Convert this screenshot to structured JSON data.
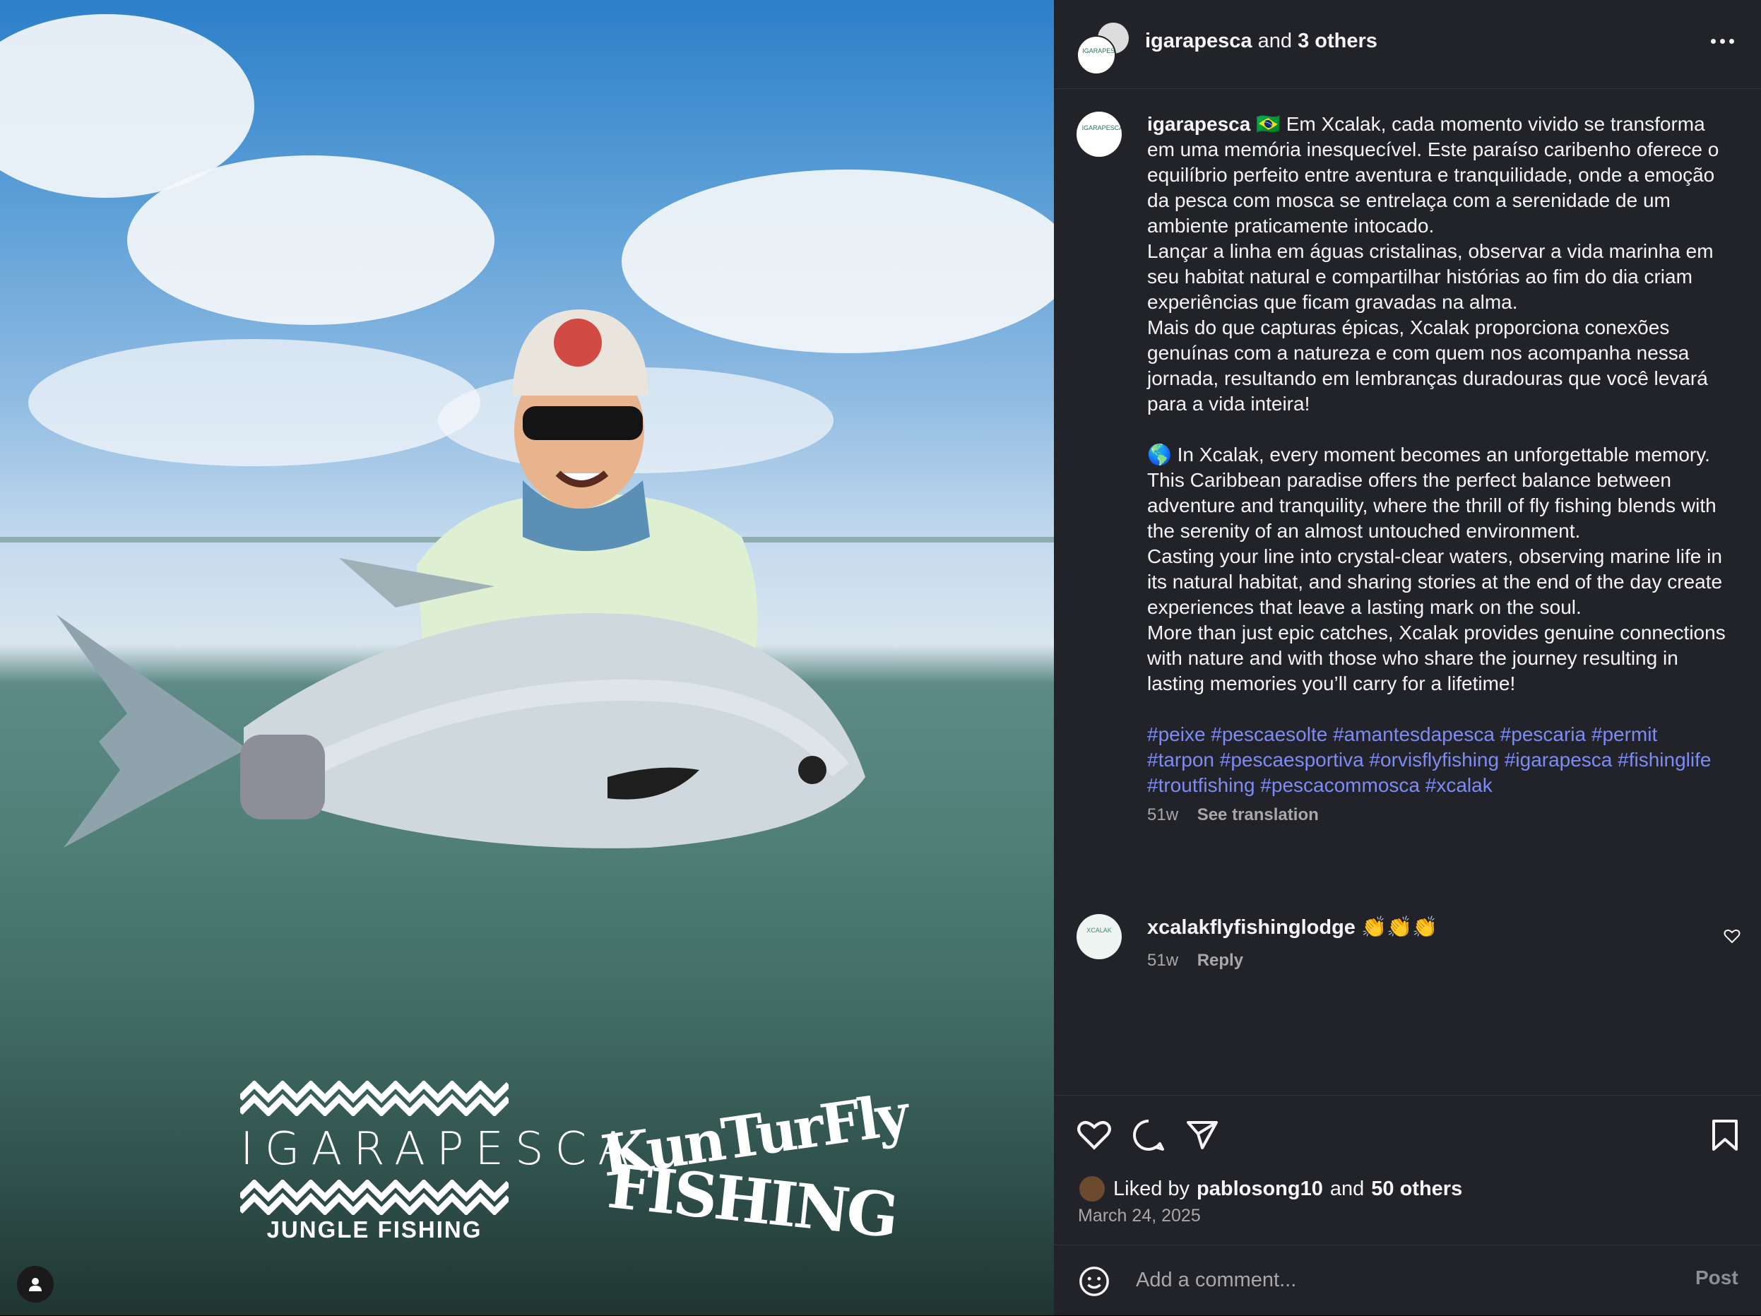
{
  "post": {
    "author": "igarapesca",
    "coauthors_suffix": "and",
    "coauthors_count": "3 others",
    "caption_lines_pt": [
      "🇧🇷 Em Xcalak, cada momento vivido se transforma em uma memória inesquecível. Este paraíso caribenho oferece o equilíbrio perfeito entre aventura e tranquilidade, onde a emoção da pesca com mosca se entrelaça com a serenidade de um ambiente praticamente intocado.",
      "Lançar a linha em águas cristalinas, observar a vida marinha em seu habitat natural e compartilhar histórias ao fim do dia criam experiências que ficam gravadas na alma.",
      "Mais do que capturas épicas, Xcalak proporciona conexões genuínas com a natureza e com quem nos acompanha nessa jornada, resultando em lembranças duradouras que você levará para a vida inteira!"
    ],
    "caption_lines_en": [
      "🌎 In Xcalak, every moment becomes an unforgettable memory. This Caribbean paradise offers the perfect balance between adventure and tranquility, where the thrill of fly fishing blends with the serenity of an almost untouched environment.",
      "Casting your line into crystal-clear waters, observing marine life in its natural habitat, and sharing stories at the end of the day create experiences that leave a lasting mark on the soul.",
      "More than just epic catches, Xcalak provides genuine connections with nature and with those who share the journey resulting in lasting memories you’ll carry for a lifetime!"
    ],
    "hashtags": "#peixe #pescaesolte #amantesdapesca #pescaria #permit #tarpon #pescaesportiva #orvisflyfishing #igarapesca #fishinglife #troutfishing #pescacommosca #xcalak",
    "age": "51w",
    "see_translation": "See translation",
    "likes_prefix": "Liked by",
    "liked_by_user": "pablosong10",
    "likes_and": "and",
    "likes_others": "50 others",
    "date": "March 24, 2025"
  },
  "comment": {
    "user": "xcalakflyfishinglodge",
    "text": "👏👏👏",
    "age": "51w",
    "reply_label": "Reply"
  },
  "comment_input": {
    "placeholder": "Add a comment...",
    "post_label": "Post"
  },
  "media": {
    "logo_left_word": "IGARAPESCA",
    "logo_left_sub": "JUNGLE FISHING",
    "logo_right_line1": "KunTurFly",
    "logo_right_line2": "FISHING"
  },
  "avatar_text": {
    "igarapesca": "IGARAPESCA",
    "xcalak": "XCALAK"
  },
  "colors": {
    "panel_bg": "#212328",
    "hashtag": "#7d8cf4",
    "muted": "#a8a8a8"
  },
  "icons": [
    "more-icon",
    "heart-icon",
    "comment-icon",
    "share-icon",
    "bookmark-icon",
    "emoji-icon",
    "user-tag-icon"
  ]
}
